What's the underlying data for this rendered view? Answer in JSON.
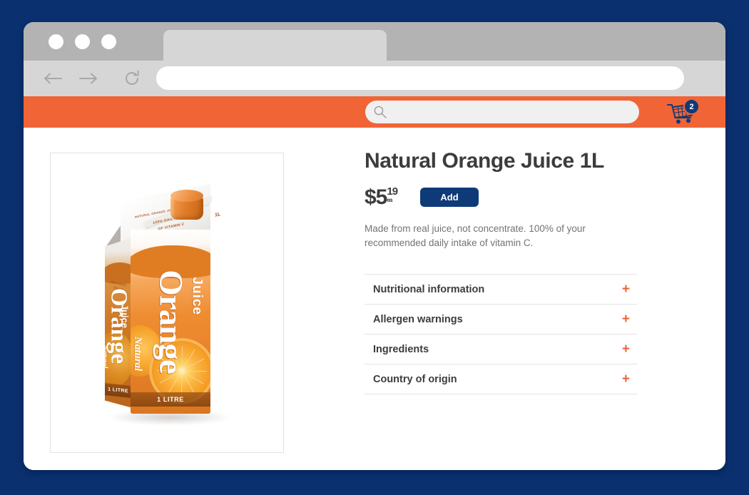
{
  "theme": {
    "page_background": "#0a3070",
    "brand_orange": "#f06435",
    "brand_navy": "#0f3a78",
    "text_dark": "#3c3c3c",
    "text_muted": "#737373"
  },
  "browser": {
    "window_controls": [
      "close",
      "minimize",
      "maximize"
    ],
    "tab": {
      "title": ""
    },
    "nav": {
      "back_icon": "arrow-left-icon",
      "forward_icon": "arrow-right-icon",
      "reload_icon": "reload-icon"
    },
    "url_bar": {
      "value": "",
      "placeholder": ""
    }
  },
  "site_header": {
    "search": {
      "value": "",
      "placeholder": "",
      "icon": "search-icon"
    },
    "cart": {
      "icon": "shopping-cart-icon",
      "badge_count": "2"
    }
  },
  "product": {
    "title": "Natural Orange Juice 1L",
    "price": {
      "currency_and_dollars": "$5",
      "cents": "19",
      "unit": "ea"
    },
    "add_button_label": "Add",
    "description": "Made from real juice, not concentrate. 100% of your recommended daily intake of vitamin C.",
    "image": {
      "alt": "Orange juice carton",
      "carton_front_brand": "Orange",
      "carton_front_natural": "Natural",
      "carton_front_juice": "Juice",
      "carton_top_line1": "100% DAILY VALUE",
      "carton_top_line2": "OF VITAMIN C",
      "carton_top_brandline": "NATURAL ORANGE JUICE",
      "carton_top_volume": "1L",
      "carton_side_line1": "100% DAILY",
      "carton_side_line2": "VALUE",
      "carton_volume_band": "1 LITRE"
    }
  },
  "accordion": {
    "expand_icon": "plus-icon",
    "rows": [
      {
        "label": "Nutritional information"
      },
      {
        "label": "Allergen warnings"
      },
      {
        "label": "Ingredients"
      },
      {
        "label": "Country of origin"
      }
    ]
  }
}
